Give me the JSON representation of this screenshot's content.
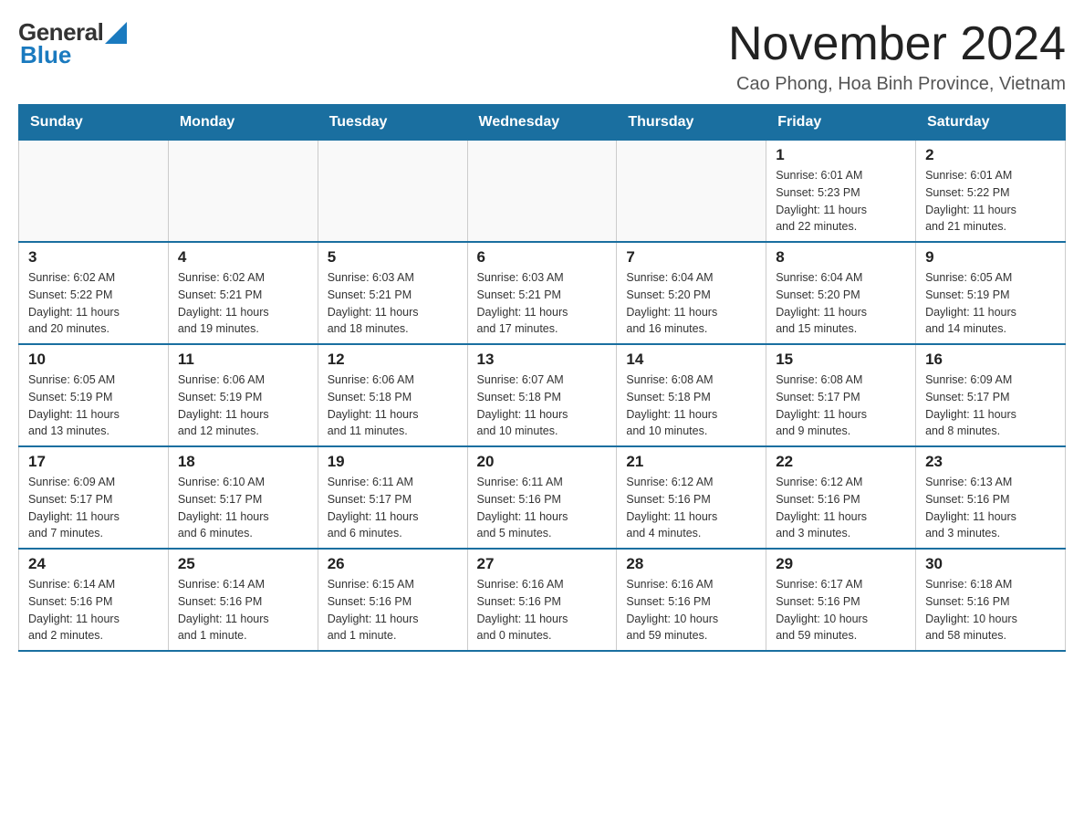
{
  "header": {
    "logo_general": "General",
    "logo_blue": "Blue",
    "month_title": "November 2024",
    "location": "Cao Phong, Hoa Binh Province, Vietnam"
  },
  "weekdays": [
    "Sunday",
    "Monday",
    "Tuesday",
    "Wednesday",
    "Thursday",
    "Friday",
    "Saturday"
  ],
  "weeks": [
    [
      {
        "day": "",
        "info": ""
      },
      {
        "day": "",
        "info": ""
      },
      {
        "day": "",
        "info": ""
      },
      {
        "day": "",
        "info": ""
      },
      {
        "day": "",
        "info": ""
      },
      {
        "day": "1",
        "info": "Sunrise: 6:01 AM\nSunset: 5:23 PM\nDaylight: 11 hours\nand 22 minutes."
      },
      {
        "day": "2",
        "info": "Sunrise: 6:01 AM\nSunset: 5:22 PM\nDaylight: 11 hours\nand 21 minutes."
      }
    ],
    [
      {
        "day": "3",
        "info": "Sunrise: 6:02 AM\nSunset: 5:22 PM\nDaylight: 11 hours\nand 20 minutes."
      },
      {
        "day": "4",
        "info": "Sunrise: 6:02 AM\nSunset: 5:21 PM\nDaylight: 11 hours\nand 19 minutes."
      },
      {
        "day": "5",
        "info": "Sunrise: 6:03 AM\nSunset: 5:21 PM\nDaylight: 11 hours\nand 18 minutes."
      },
      {
        "day": "6",
        "info": "Sunrise: 6:03 AM\nSunset: 5:21 PM\nDaylight: 11 hours\nand 17 minutes."
      },
      {
        "day": "7",
        "info": "Sunrise: 6:04 AM\nSunset: 5:20 PM\nDaylight: 11 hours\nand 16 minutes."
      },
      {
        "day": "8",
        "info": "Sunrise: 6:04 AM\nSunset: 5:20 PM\nDaylight: 11 hours\nand 15 minutes."
      },
      {
        "day": "9",
        "info": "Sunrise: 6:05 AM\nSunset: 5:19 PM\nDaylight: 11 hours\nand 14 minutes."
      }
    ],
    [
      {
        "day": "10",
        "info": "Sunrise: 6:05 AM\nSunset: 5:19 PM\nDaylight: 11 hours\nand 13 minutes."
      },
      {
        "day": "11",
        "info": "Sunrise: 6:06 AM\nSunset: 5:19 PM\nDaylight: 11 hours\nand 12 minutes."
      },
      {
        "day": "12",
        "info": "Sunrise: 6:06 AM\nSunset: 5:18 PM\nDaylight: 11 hours\nand 11 minutes."
      },
      {
        "day": "13",
        "info": "Sunrise: 6:07 AM\nSunset: 5:18 PM\nDaylight: 11 hours\nand 10 minutes."
      },
      {
        "day": "14",
        "info": "Sunrise: 6:08 AM\nSunset: 5:18 PM\nDaylight: 11 hours\nand 10 minutes."
      },
      {
        "day": "15",
        "info": "Sunrise: 6:08 AM\nSunset: 5:17 PM\nDaylight: 11 hours\nand 9 minutes."
      },
      {
        "day": "16",
        "info": "Sunrise: 6:09 AM\nSunset: 5:17 PM\nDaylight: 11 hours\nand 8 minutes."
      }
    ],
    [
      {
        "day": "17",
        "info": "Sunrise: 6:09 AM\nSunset: 5:17 PM\nDaylight: 11 hours\nand 7 minutes."
      },
      {
        "day": "18",
        "info": "Sunrise: 6:10 AM\nSunset: 5:17 PM\nDaylight: 11 hours\nand 6 minutes."
      },
      {
        "day": "19",
        "info": "Sunrise: 6:11 AM\nSunset: 5:17 PM\nDaylight: 11 hours\nand 6 minutes."
      },
      {
        "day": "20",
        "info": "Sunrise: 6:11 AM\nSunset: 5:16 PM\nDaylight: 11 hours\nand 5 minutes."
      },
      {
        "day": "21",
        "info": "Sunrise: 6:12 AM\nSunset: 5:16 PM\nDaylight: 11 hours\nand 4 minutes."
      },
      {
        "day": "22",
        "info": "Sunrise: 6:12 AM\nSunset: 5:16 PM\nDaylight: 11 hours\nand 3 minutes."
      },
      {
        "day": "23",
        "info": "Sunrise: 6:13 AM\nSunset: 5:16 PM\nDaylight: 11 hours\nand 3 minutes."
      }
    ],
    [
      {
        "day": "24",
        "info": "Sunrise: 6:14 AM\nSunset: 5:16 PM\nDaylight: 11 hours\nand 2 minutes."
      },
      {
        "day": "25",
        "info": "Sunrise: 6:14 AM\nSunset: 5:16 PM\nDaylight: 11 hours\nand 1 minute."
      },
      {
        "day": "26",
        "info": "Sunrise: 6:15 AM\nSunset: 5:16 PM\nDaylight: 11 hours\nand 1 minute."
      },
      {
        "day": "27",
        "info": "Sunrise: 6:16 AM\nSunset: 5:16 PM\nDaylight: 11 hours\nand 0 minutes."
      },
      {
        "day": "28",
        "info": "Sunrise: 6:16 AM\nSunset: 5:16 PM\nDaylight: 10 hours\nand 59 minutes."
      },
      {
        "day": "29",
        "info": "Sunrise: 6:17 AM\nSunset: 5:16 PM\nDaylight: 10 hours\nand 59 minutes."
      },
      {
        "day": "30",
        "info": "Sunrise: 6:18 AM\nSunset: 5:16 PM\nDaylight: 10 hours\nand 58 minutes."
      }
    ]
  ]
}
